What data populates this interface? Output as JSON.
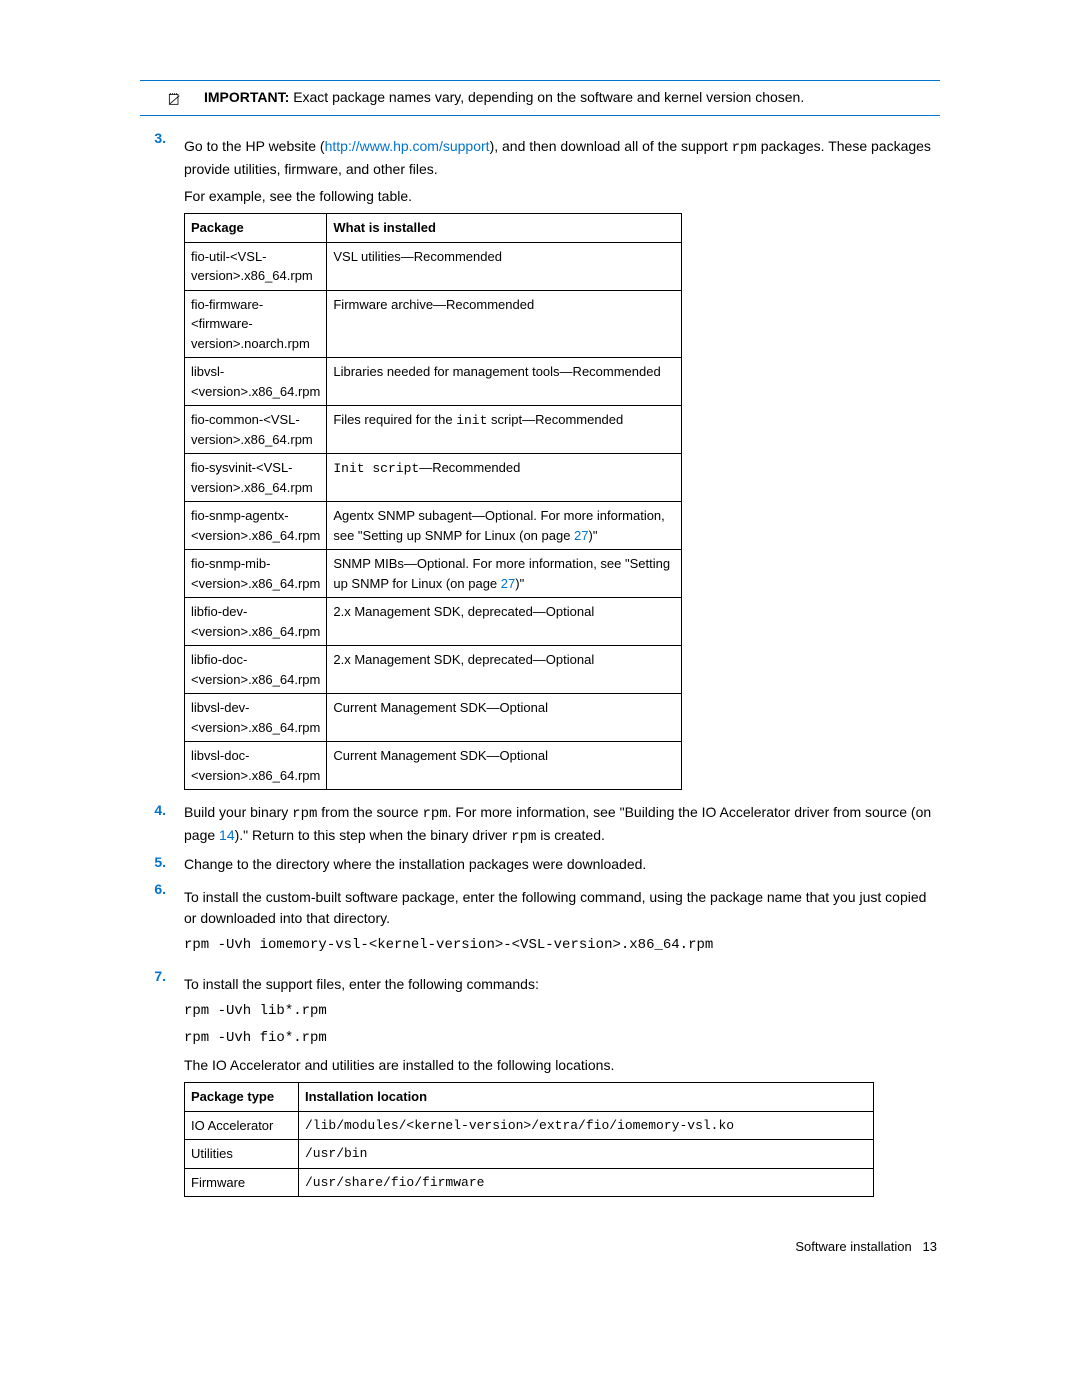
{
  "important": {
    "label": "IMPORTANT:",
    "text": "Exact package names vary, depending on the software and kernel version chosen."
  },
  "step3": {
    "num": "3.",
    "text_a": "Go to the HP website (",
    "link": "http://www.hp.com/support",
    "text_b": "), and then download all of the support ",
    "code": "rpm",
    "text_c": " packages. These packages provide utilities, firmware, and other files.",
    "para2": "For example, see the following table."
  },
  "table1": {
    "headers": [
      "Package",
      "What is installed"
    ],
    "rows": [
      {
        "pkg": "fio-util-<VSL-version>.x86_64.rpm",
        "desc": "VSL utilities—Recommended"
      },
      {
        "pkg": "fio-firmware-<firmware-version>.noarch.rpm",
        "desc": "Firmware archive—Recommended"
      },
      {
        "pkg": "libvsl-<version>.x86_64.rpm",
        "desc": "Libraries needed for management tools—Recommended"
      },
      {
        "pkg": "fio-common-<VSL-version>.x86_64.rpm",
        "desc_a": "Files required for the ",
        "code": "init",
        "desc_b": " script—Recommended"
      },
      {
        "pkg": "fio-sysvinit-<VSL-version>.x86_64.rpm",
        "code_a": "Init script",
        "desc_b": "—Recommended"
      },
      {
        "pkg": "fio-snmp-agentx-<version>.x86_64.rpm",
        "desc_a": "Agentx SNMP subagent—Optional. For more information, see \"Setting up SNMP for Linux (on page ",
        "link": "27",
        "desc_b": ")\""
      },
      {
        "pkg": "fio-snmp-mib-<version>.x86_64.rpm",
        "desc_a": "SNMP MIBs—Optional. For more information, see \"Setting up SNMP for Linux (on page ",
        "link": "27",
        "desc_b": ")\""
      },
      {
        "pkg": "libfio-dev-<version>.x86_64.rpm",
        "desc": "2.x Management SDK, deprecated—Optional"
      },
      {
        "pkg": "libfio-doc-<version>.x86_64.rpm",
        "desc": "2.x Management SDK, deprecated—Optional"
      },
      {
        "pkg": "libvsl-dev-<version>.x86_64.rpm",
        "desc": "Current Management SDK—Optional"
      },
      {
        "pkg": "libvsl-doc-<version>.x86_64.rpm",
        "desc": "Current Management SDK—Optional"
      }
    ]
  },
  "step4": {
    "num": "4.",
    "text_a": "Build your binary ",
    "code_a": "rpm",
    "text_b": " from the source ",
    "code_b": "rpm",
    "text_c": ". For more information, see \"Building the IO Accelerator driver from source (on page ",
    "link": "14",
    "text_d": ").\" Return to this step when the binary driver ",
    "code_c": "rpm",
    "text_e": " is created."
  },
  "step5": {
    "num": "5.",
    "text": "Change to the directory where the installation packages were downloaded."
  },
  "step6": {
    "num": "6.",
    "text": "To install the custom-built software package, enter the following command, using the package name that you just copied or downloaded into that directory.",
    "code": "rpm -Uvh iomemory-vsl-<kernel-version>-<VSL-version>.x86_64.rpm"
  },
  "step7": {
    "num": "7.",
    "text": "To install the support files, enter the following commands:",
    "code1": "rpm -Uvh lib*.rpm",
    "code2": "rpm -Uvh fio*.rpm",
    "para2": "The IO Accelerator and utilities are installed to the following locations."
  },
  "table2": {
    "headers": [
      "Package type",
      "Installation location"
    ],
    "rows": [
      {
        "type": "IO Accelerator",
        "loc": "/lib/modules/<kernel-version>/extra/fio/iomemory-vsl.ko"
      },
      {
        "type": "Utilities",
        "loc": "/usr/bin"
      },
      {
        "type": "Firmware",
        "loc": "/usr/share/fio/firmware"
      }
    ]
  },
  "footer": {
    "section": "Software installation",
    "page": "13"
  }
}
